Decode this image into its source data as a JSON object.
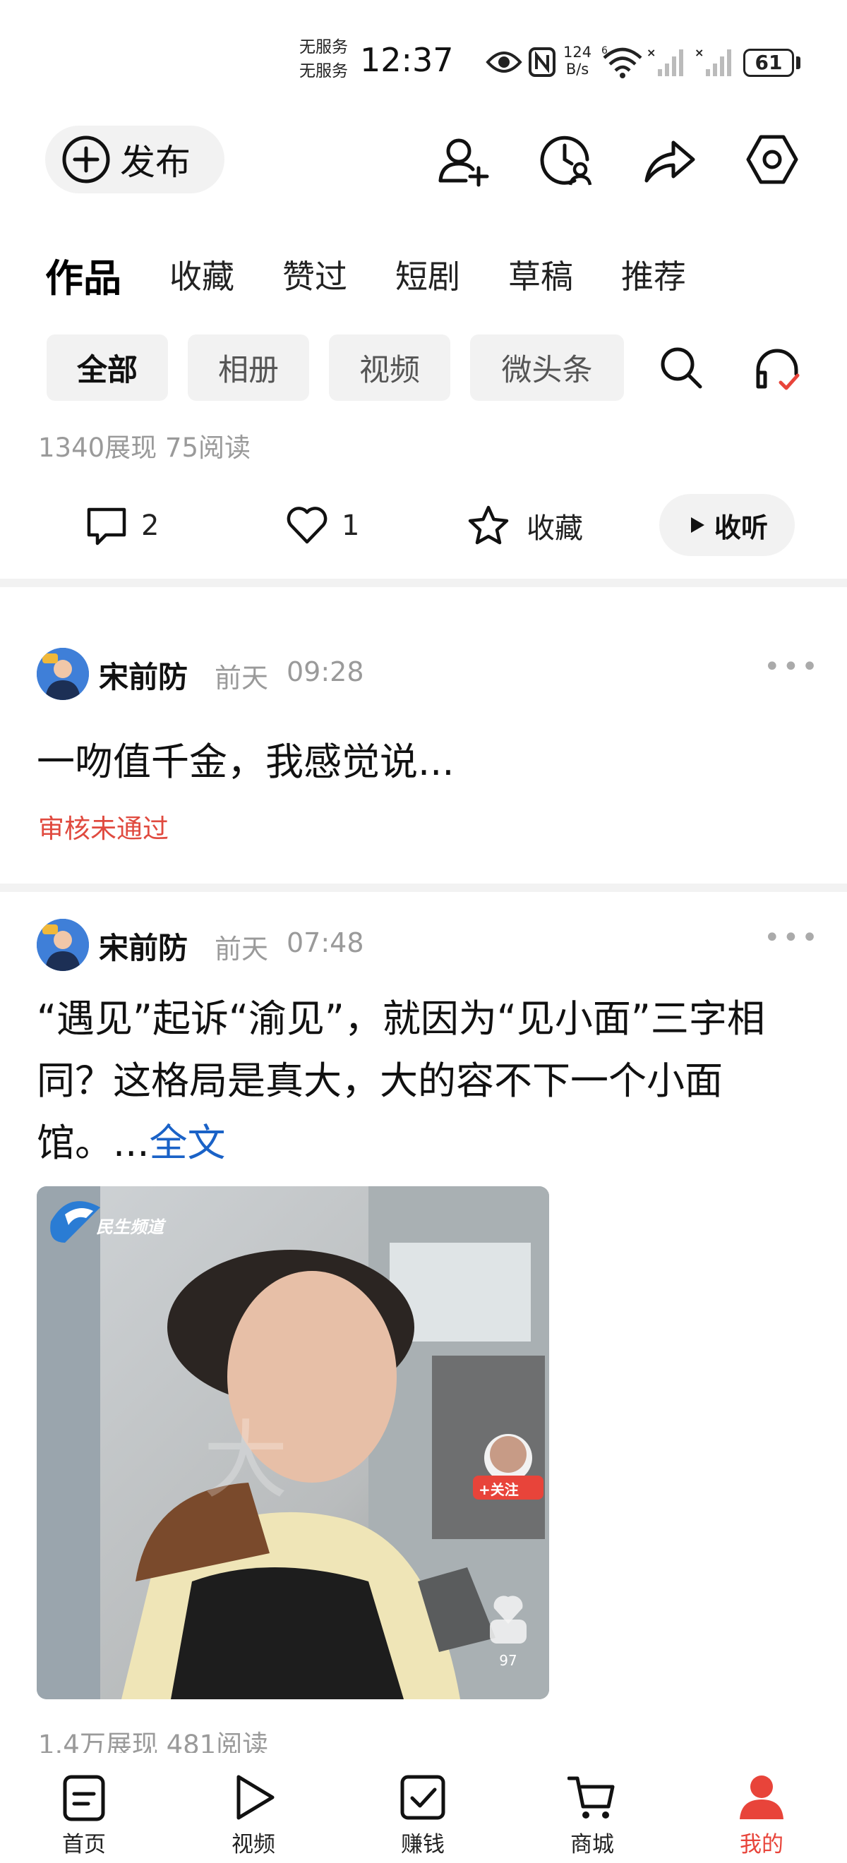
{
  "status_bar": {
    "carrier_line1": "无服务",
    "carrier_line2": "无服务",
    "time": "12:37",
    "net_speed_value": "124",
    "net_speed_unit": "B/s",
    "battery": "61",
    "icons": [
      "eye-icon",
      "nfc-icon",
      "wifi-icon",
      "signal-icon",
      "signal-icon",
      "battery-icon"
    ]
  },
  "toolbar": {
    "publish_label": "发布",
    "icons": [
      "add-friend-icon",
      "history-icon",
      "share-icon",
      "settings-icon"
    ]
  },
  "tabs": [
    {
      "label": "作品",
      "active": true
    },
    {
      "label": "收藏",
      "active": false
    },
    {
      "label": "赞过",
      "active": false
    },
    {
      "label": "短剧",
      "active": false
    },
    {
      "label": "草稿",
      "active": false
    },
    {
      "label": "推荐",
      "active": false
    }
  ],
  "filters": [
    {
      "label": "全部",
      "active": true
    },
    {
      "label": "相册",
      "active": false
    },
    {
      "label": "视频",
      "active": false
    },
    {
      "label": "微头条",
      "active": false
    }
  ],
  "prev_post": {
    "stats": "1340展现   75阅读",
    "comments": "2",
    "likes": "1",
    "collect_label": "收藏",
    "listen_label": "收听"
  },
  "posts": [
    {
      "author": "宋前防",
      "date_label": "前天",
      "time": "09:28",
      "text": "一吻值千金，我感觉说...",
      "status": "审核未通过"
    },
    {
      "author": "宋前防",
      "date_label": "前天",
      "time": "07:48",
      "text_line1": "“遇见”起诉“渝见”，就因为“见小面”三字相",
      "text_line2": "同？这格局是真大，大的容不下一个小面",
      "text_line3": "馆。...",
      "read_more": "全文",
      "thumb_channel": "民生频道",
      "thumb_follow": "+关注",
      "thumb_comments": "97",
      "stats": "1.4万展现   481阅读"
    }
  ],
  "bottom_nav": [
    {
      "label": "首页",
      "icon": "home-icon",
      "active": false
    },
    {
      "label": "视频",
      "icon": "video-icon",
      "active": false
    },
    {
      "label": "赚钱",
      "icon": "task-icon",
      "active": false
    },
    {
      "label": "商城",
      "icon": "cart-icon",
      "active": false
    },
    {
      "label": "我的",
      "icon": "profile-icon",
      "active": true
    }
  ],
  "colors": {
    "accent_red": "#e8443a",
    "reject_red": "#e04a3f",
    "link_blue": "#1a62c7",
    "chip_bg": "#f2f2f2",
    "muted_text": "#9a9a9a"
  }
}
